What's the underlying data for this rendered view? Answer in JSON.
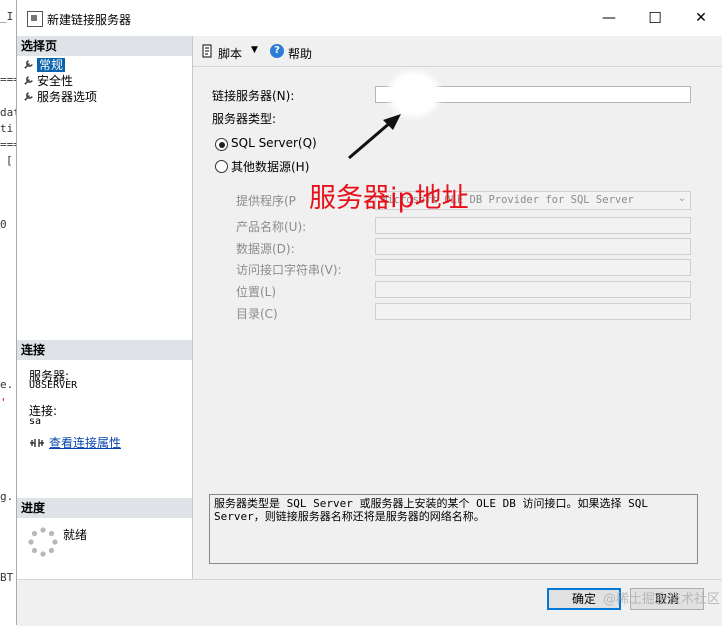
{
  "background_editor": {
    "line_texts": [
      "_I",
      "===",
      "dat",
      "ti",
      "===",
      "[",
      "0",
      "e.",
      "'",
      "g.",
      "BT"
    ]
  },
  "window": {
    "title": "新建链接服务器",
    "controls": {
      "minimize": "—",
      "maximize": "☐",
      "close": "✕"
    }
  },
  "left_panel": {
    "select_page_header": "选择页",
    "pages": [
      {
        "label": "常规",
        "selected": true
      },
      {
        "label": "安全性",
        "selected": false
      },
      {
        "label": "服务器选项",
        "selected": false
      }
    ],
    "connection_header": "连接",
    "server_label": "服务器:",
    "server_value": "U8SERVER",
    "connection_label": "连接:",
    "connection_value": "sa",
    "view_connection_properties": "查看连接属性",
    "progress_header": "进度",
    "progress_status": "就绪"
  },
  "toolbar": {
    "script_label": "脚本",
    "help_label": "帮助"
  },
  "form": {
    "linked_server_label": "链接服务器(N):",
    "linked_server_value": "",
    "server_type_label": "服务器类型:",
    "sql_server_option": "SQL Server(Q)",
    "other_source_option": "其他数据源(H)",
    "selected_server_type": "SQL Server",
    "provider_label": "提供程序(P",
    "provider_value": "Microsoft OLE DB Provider for SQL Server",
    "product_name_label": "产品名称(U):",
    "data_source_label": "数据源(D):",
    "provider_string_label": "访问接口字符串(V):",
    "location_label": "位置(L)",
    "catalog_label": "目录(C)"
  },
  "description": "服务器类型是 SQL Server 或服务器上安装的某个 OLE DB 访问接口。如果选择 SQL Server，则链接服务器名称还将是服务器的网络名称。",
  "buttons": {
    "ok": "确定",
    "cancel": "取消"
  },
  "annotation": {
    "text": "服务器ip地址",
    "color": "#e8101a"
  },
  "watermark": "@稀土掘金技术社区"
}
